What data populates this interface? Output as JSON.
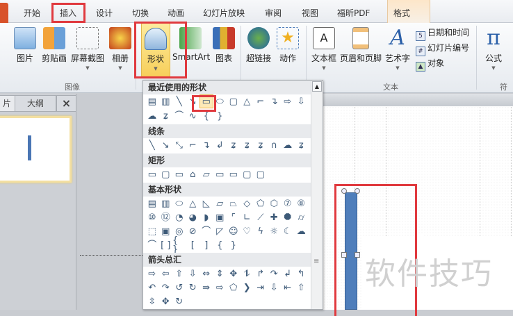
{
  "tabs": [
    "开始",
    "插入",
    "设计",
    "切换",
    "动画",
    "幻灯片放映",
    "审阅",
    "视图",
    "福昕PDF",
    "格式"
  ],
  "ribbon": {
    "images_group": {
      "label": "图像",
      "buttons": [
        "图片",
        "剪贴画",
        "屏幕截图",
        "相册"
      ]
    },
    "illustrations": {
      "buttons": [
        "形状",
        "SmartArt",
        "图表"
      ]
    },
    "links": {
      "buttons": [
        "超链接",
        "动作"
      ]
    },
    "text_group": {
      "label": "文本",
      "buttons": [
        "文本框",
        "页眉和页脚",
        "艺术字"
      ],
      "small": [
        "日期和时间",
        "幻灯片编号",
        "对象"
      ]
    },
    "symbols_group": {
      "label": "符号",
      "buttons": [
        "公式"
      ]
    }
  },
  "left_panel": {
    "tabs": [
      "片",
      "大纲"
    ],
    "close": "×"
  },
  "watermark": "软件技巧",
  "shapes_menu": {
    "sections": [
      {
        "title": "最近使用的形状",
        "rows": [
          [
            "▤",
            "▥",
            "╲",
            "↘",
            "▭",
            "⬭",
            "▢",
            "△",
            "⌐",
            "↴",
            "⇨",
            "⇩"
          ],
          [
            "☁",
            "ʑ",
            "⌒",
            "∿",
            "{",
            "}"
          ]
        ]
      },
      {
        "title": "线条",
        "rows": [
          [
            "╲",
            "↘",
            "⤡",
            "⌐",
            "↴",
            "↲",
            "ʑ",
            "ʑ",
            "ʑ",
            "∩",
            "☁",
            "ʑ"
          ]
        ]
      },
      {
        "title": "矩形",
        "rows": [
          [
            "▭",
            "▢",
            "▭",
            "⌂",
            "▱",
            "▭",
            "▭",
            "▢",
            "▢"
          ]
        ]
      },
      {
        "title": "基本形状",
        "rows": [
          [
            "▤",
            "▥",
            "⬭",
            "△",
            "◺",
            "▱",
            "⏢",
            "◇",
            "⬠",
            "⬡",
            "⑦",
            "⑧"
          ],
          [
            "⑩",
            "⑫",
            "◔",
            "◕",
            "◗",
            "▣",
            "⌜",
            "∟",
            "⟋",
            "✚",
            "⯃",
            "⌭"
          ],
          [
            "⬚",
            "▣",
            "◎",
            "⊘",
            "⌒",
            "◸",
            "☺",
            "♡",
            "ϟ",
            "☼",
            "☾",
            "☁"
          ],
          [
            "⌒",
            "[ ]",
            "{ }",
            "[",
            "]",
            "{",
            "}"
          ]
        ]
      },
      {
        "title": "箭头总汇",
        "rows": [
          [
            "⇨",
            "⇦",
            "⇧",
            "⇩",
            "⇔",
            "⇕",
            "✥",
            "⥮",
            "↱",
            "↷",
            "↲",
            "↰"
          ],
          [
            "↶",
            "↷",
            "↺",
            "↻",
            "⇛",
            "⇨",
            "⬠",
            "❯",
            "⇥",
            "⇩",
            "⇤",
            "⇧"
          ],
          [
            "⇳",
            "✥",
            "↻"
          ]
        ]
      }
    ]
  },
  "colors": {
    "accent_red": "#e0393e",
    "shape_fill": "#4f7ebb"
  }
}
